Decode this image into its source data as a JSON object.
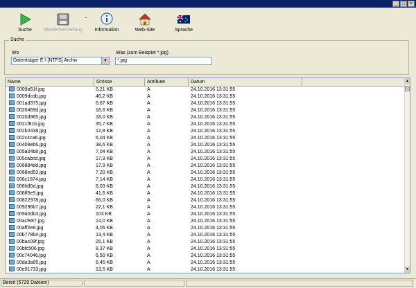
{
  "toolbar": {
    "search_label": "Suche",
    "restore_label": "Wiederherstellung",
    "info_label": "Information",
    "website_label": "Web-Site",
    "language_label": "Sprache"
  },
  "search": {
    "group_title": "Suche",
    "where_label": "Wo",
    "where_value": "Datenträger E:\\ [NTFS] Archiv",
    "what_label": "Was (zum Beispiel *.jpg)",
    "what_value": "*.jpg"
  },
  "table": {
    "columns": [
      "Name",
      "Grösse",
      "Attribute",
      "Datum"
    ],
    "rows": [
      [
        "0009a51f.jpg",
        "5,21 KB",
        "A",
        "24.10.2016 13:31:55"
      ],
      [
        "0009dcdb.jpg",
        "46,2 KB",
        "A",
        "24.10.2016 13:31:55"
      ],
      [
        "001ad375.jpg",
        "6,67 KB",
        "A",
        "24.10.2016 13:31:55"
      ],
      [
        "0020469d.jpg",
        "18,6 KB",
        "A",
        "24.10.2016 13:31:55"
      ],
      [
        "0020d965.jpg",
        "18,0 KB",
        "A",
        "24.10.2016 13:31:55"
      ],
      [
        "0021f81b.jpg",
        "35,7 KB",
        "A",
        "24.10.2016 13:31:55"
      ],
      [
        "002b2438.jpg",
        "12,8 KB",
        "A",
        "24.10.2016 13:31:55"
      ],
      [
        "002c4ca6.jpg",
        "6,04 KB",
        "A",
        "24.10.2016 13:31:55"
      ],
      [
        "00408eb6.jpg",
        "38,6 KB",
        "A",
        "24.10.2016 13:31:55"
      ],
      [
        "005a04b8.jpg",
        "7,04 KB",
        "A",
        "24.10.2016 13:31:55"
      ],
      [
        "005cabcd.jpg",
        "17,9 KB",
        "A",
        "24.10.2016 13:31:55"
      ],
      [
        "006884dd.jpg",
        "17,9 KB",
        "A",
        "24.10.2016 13:31:55"
      ],
      [
        "0068ed53.jpg",
        "7,20 KB",
        "A",
        "24.10.2016 13:31:55"
      ],
      [
        "006c1874.jpg",
        "7,14 KB",
        "A",
        "24.10.2016 13:31:55"
      ],
      [
        "006fdf0d.jpg",
        "8,03 KB",
        "A",
        "24.10.2016 13:31:55"
      ],
      [
        "006ff5e9.jpg",
        "41,6 KB",
        "A",
        "24.10.2016 13:31:55"
      ],
      [
        "00822978.jpg",
        "66,0 KB",
        "A",
        "24.10.2016 13:31:55"
      ],
      [
        "009296b7.jpg",
        "22,1 KB",
        "A",
        "24.10.2016 13:31:55"
      ],
      [
        "009a0db3.jpg",
        "103 KB",
        "A",
        "24.10.2016 13:31:55"
      ],
      [
        "00acfe87.jpg",
        "14,0 KB",
        "A",
        "24.10.2016 13:31:55"
      ],
      [
        "00aff2e8.jpg",
        "4,05 KB",
        "A",
        "24.10.2016 13:31:55"
      ],
      [
        "00b778b4.jpg",
        "13,4 KB",
        "A",
        "24.10.2016 13:31:55"
      ],
      [
        "00bac09f.jpg",
        "25,1 KB",
        "A",
        "24.10.2016 13:31:55"
      ],
      [
        "00bfc506.jpg",
        "8,37 KB",
        "A",
        "24.10.2016 13:31:55"
      ],
      [
        "00c74046.jpg",
        "6,50 KB",
        "A",
        "24.10.2016 13:31:55"
      ],
      [
        "00da3a85.jpg",
        "6,45 KB",
        "A",
        "24.10.2016 13:31:55"
      ],
      [
        "00e91733.jpg",
        "13,5 KB",
        "A",
        "24.10.2016 13:31:55"
      ]
    ]
  },
  "statusbar": {
    "text": "Bereit (5729 Dateien)"
  },
  "window": {
    "minimize_label": "_",
    "maximize_label": "□",
    "close_label": "×"
  },
  "icons": {
    "search": "play-icon",
    "restore": "floppy-disk-icon",
    "info": "info-icon",
    "website": "house-icon",
    "language": "australia-flag-icon"
  }
}
